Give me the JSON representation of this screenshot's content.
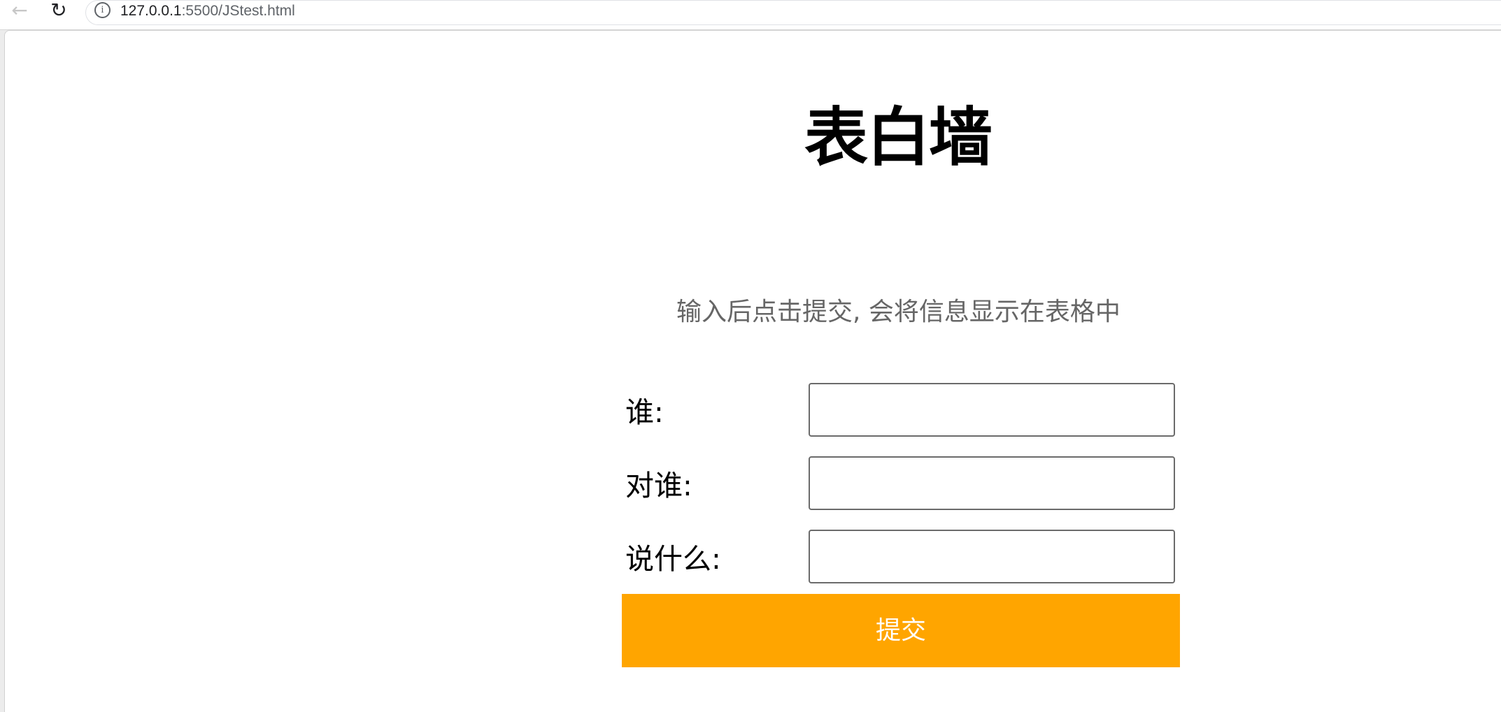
{
  "browser": {
    "back_icon": "←",
    "reload_icon": "↻",
    "info_icon": "i",
    "address_host": "127.0.0.1",
    "address_path": ":5500/JStest.html"
  },
  "page": {
    "title": "表白墙",
    "instruction": "输入后点击提交, 会将信息显示在表格中"
  },
  "form": {
    "fields": [
      {
        "label": "谁:",
        "value": "",
        "placeholder": ""
      },
      {
        "label": "对谁:",
        "value": "",
        "placeholder": ""
      },
      {
        "label": "说什么:",
        "value": "",
        "placeholder": ""
      }
    ],
    "submit_label": "提交"
  },
  "colors": {
    "submit_background": "#ffa500",
    "submit_text": "#ffffff",
    "instruction_text": "#666666",
    "input_border": "#6b6b6b"
  }
}
